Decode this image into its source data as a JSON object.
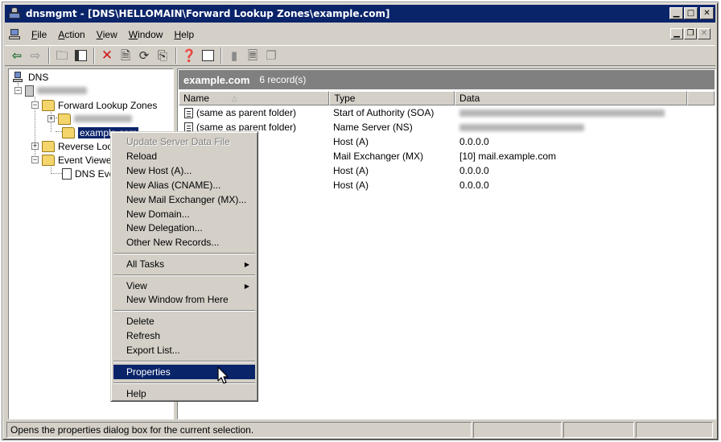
{
  "window": {
    "title": "dnsmgmt - [DNS\\HELLOMAIN\\Forward Lookup Zones\\example.com]"
  },
  "menubar": {
    "items": [
      {
        "label": "File",
        "u": "F",
        "rest": "ile"
      },
      {
        "label": "Action",
        "u": "A",
        "rest": "ction"
      },
      {
        "label": "View",
        "u": "V",
        "rest": "iew"
      },
      {
        "label": "Window",
        "u": "W",
        "rest": "indow"
      },
      {
        "label": "Help",
        "u": "H",
        "rest": "elp"
      }
    ]
  },
  "tree": {
    "root": "DNS",
    "forward_zones": "Forward Lookup Zones",
    "selected_zone": "example.com",
    "reverse_zones": "Reverse Lookup Zones",
    "event_viewer": "Event Viewer",
    "dns_events": "DNS Events"
  },
  "header": {
    "title": "example.com",
    "count": "6 record(s)"
  },
  "columns": [
    "Name",
    "Type",
    "Data"
  ],
  "records": [
    {
      "name": "(same as parent folder)",
      "type": "Start of Authority (SOA)",
      "data": "",
      "data_blurred": true
    },
    {
      "name": "(same as parent folder)",
      "type": "Name Server (NS)",
      "data": "",
      "data_blurred": true
    },
    {
      "name": "",
      "type": "Host (A)",
      "data": "0.0.0.0",
      "data_blurred": false
    },
    {
      "name": "",
      "type": "Mail Exchanger (MX)",
      "data": "[10]  mail.example.com",
      "data_blurred": false
    },
    {
      "name": "",
      "type": "Host (A)",
      "data": "0.0.0.0",
      "data_blurred": false
    },
    {
      "name": "",
      "type": "Host (A)",
      "data": "0.0.0.0",
      "data_blurred": false
    }
  ],
  "context_menu": {
    "update_server": "Update Server Data File",
    "reload": "Reload",
    "new_host": "New Host (A)...",
    "new_alias": "New Alias (CNAME)...",
    "new_mx": "New Mail Exchanger (MX)...",
    "new_domain": "New Domain...",
    "new_delegation": "New Delegation...",
    "other_records": "Other New Records...",
    "all_tasks": "All Tasks",
    "view": "View",
    "new_window": "New Window from Here",
    "delete": "Delete",
    "refresh": "Refresh",
    "export_list": "Export List...",
    "properties": "Properties",
    "help": "Help"
  },
  "status": {
    "text": "Opens the properties dialog box for the current selection."
  },
  "colors": {
    "titlebar": "#0a246a",
    "face": "#d4d0c8",
    "selection": "#0a246a",
    "pane_header": "#808080"
  }
}
